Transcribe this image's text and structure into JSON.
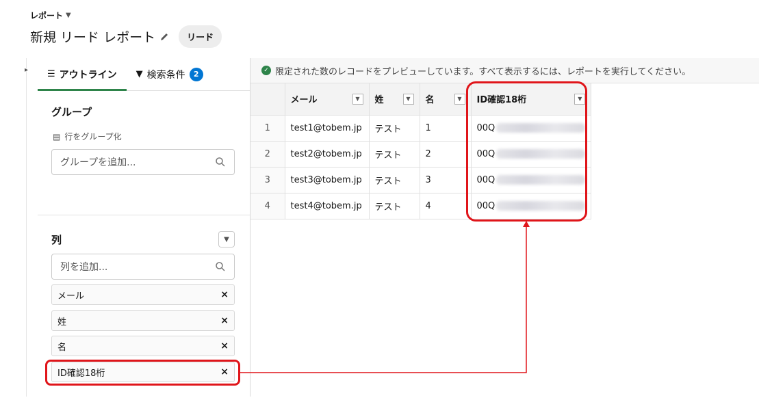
{
  "header": {
    "breadcrumb": "レポート",
    "title": "新規 リード レポート",
    "badge": "リード"
  },
  "left_panel": {
    "tabs": [
      {
        "label": "アウトライン"
      },
      {
        "label": "検索条件",
        "count": "2"
      }
    ],
    "groups": {
      "title": "グループ",
      "subtitle": "行をグループ化",
      "search_placeholder": "グループを追加..."
    },
    "columns": {
      "title": "列",
      "search_placeholder": "列を追加...",
      "items": [
        "メール",
        "姓",
        "名",
        "ID確認18桁"
      ]
    }
  },
  "preview_notice": "限定された数のレコードをプレビューしています。すべて表示するには、レポートを実行してください。",
  "table": {
    "headers": [
      "メール",
      "姓",
      "名",
      "ID確認18桁"
    ],
    "rows": [
      {
        "n": "1",
        "email": "test1@tobem.jp",
        "last": "テスト",
        "first": "1",
        "id": "00Q"
      },
      {
        "n": "2",
        "email": "test2@tobem.jp",
        "last": "テスト",
        "first": "2",
        "id": "00Q"
      },
      {
        "n": "3",
        "email": "test3@tobem.jp",
        "last": "テスト",
        "first": "3",
        "id": "00Q"
      },
      {
        "n": "4",
        "email": "test4@tobem.jp",
        "last": "テスト",
        "first": "4",
        "id": "00Q"
      }
    ]
  },
  "colors": {
    "highlight": "#e0151a",
    "accent_green": "#2e844a",
    "badge_blue": "#0176d3"
  }
}
